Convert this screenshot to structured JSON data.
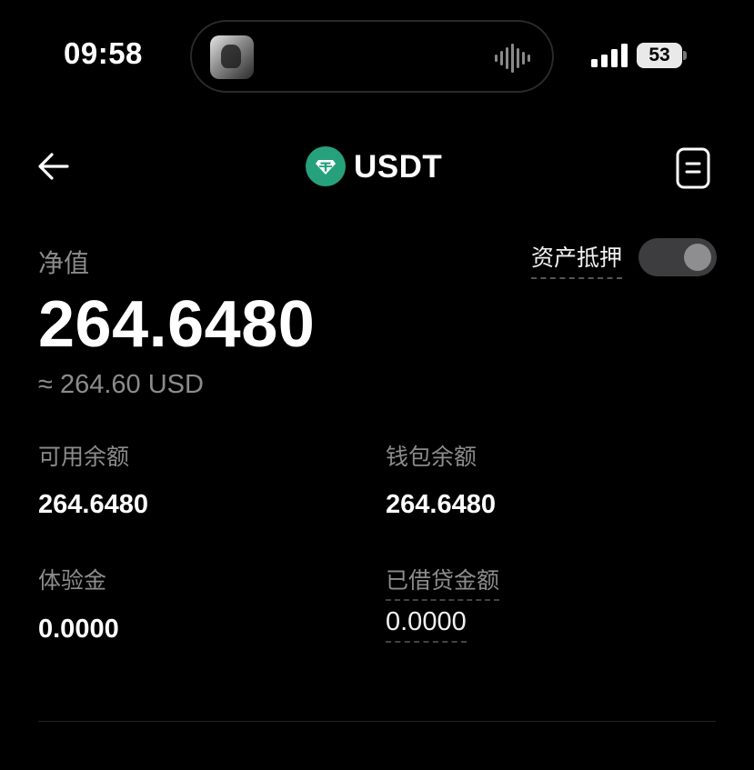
{
  "status_bar": {
    "time": "09:58",
    "battery": "53"
  },
  "header": {
    "title": "USDT",
    "coin_icon": "tether-icon",
    "back_icon": "arrow-left-icon",
    "right_icon": "document-icon"
  },
  "balance": {
    "net_label": "净值",
    "net_value": "264.6480",
    "approx_value": "≈ 264.60 USD",
    "collateral_label": "资产抵押",
    "collateral_enabled": false
  },
  "details": [
    {
      "label": "可用余额",
      "value": "264.6480"
    },
    {
      "label": "钱包余额",
      "value": "264.6480"
    },
    {
      "label": "体验金",
      "value": "0.0000"
    },
    {
      "label": "已借贷金额",
      "value": "0.0000"
    }
  ],
  "colors": {
    "background": "#000000",
    "tether_green": "#26A17B",
    "muted_text": "#8c8c8c"
  }
}
